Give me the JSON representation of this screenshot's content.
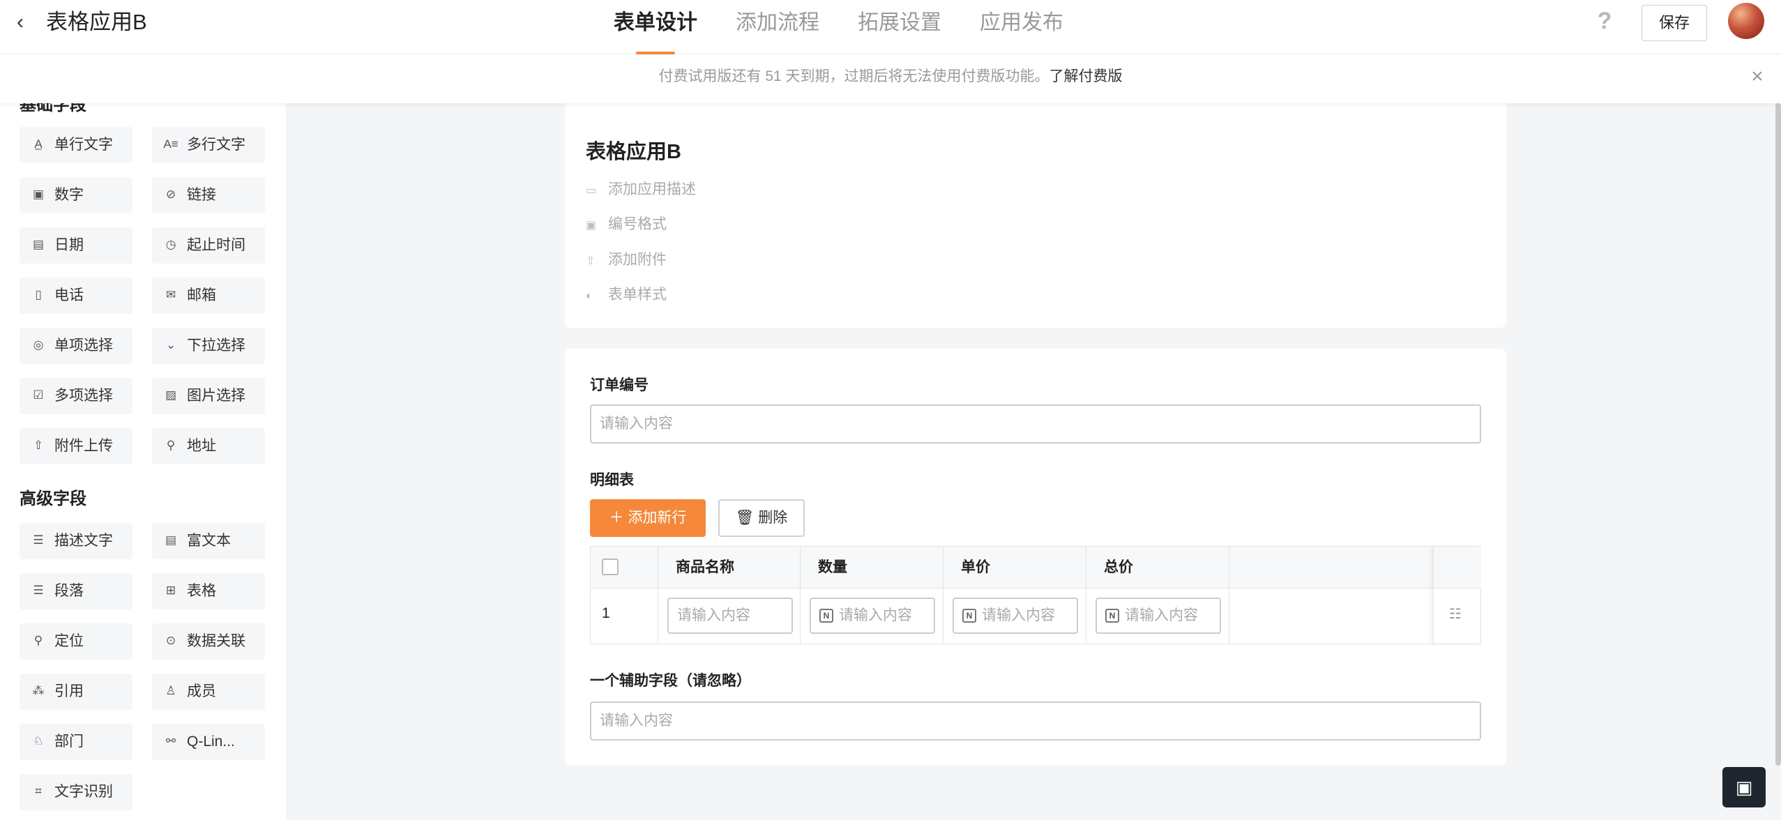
{
  "header": {
    "title": "表格应用B",
    "tabs": [
      {
        "label": "表单设计"
      },
      {
        "label": "添加流程"
      },
      {
        "label": "拓展设置"
      },
      {
        "label": "应用发布"
      }
    ],
    "help_glyph": "?",
    "save_label": "保存"
  },
  "notice": {
    "text": "付费试用版还有 51 天到期，过期后将无法使用付费版功能。",
    "link": "了解付费版"
  },
  "sidebar": {
    "basic_title": "基础字段",
    "basic_fields": [
      {
        "label": "单行文字",
        "icon": "single-line-text-icon"
      },
      {
        "label": "多行文字",
        "icon": "multi-line-text-icon"
      },
      {
        "label": "数字",
        "icon": "number-icon"
      },
      {
        "label": "链接",
        "icon": "link-icon"
      },
      {
        "label": "日期",
        "icon": "calendar-icon"
      },
      {
        "label": "起止时间",
        "icon": "time-range-icon"
      },
      {
        "label": "电话",
        "icon": "phone-icon"
      },
      {
        "label": "邮箱",
        "icon": "mail-icon"
      },
      {
        "label": "单项选择",
        "icon": "radio-icon"
      },
      {
        "label": "下拉选择",
        "icon": "dropdown-icon"
      },
      {
        "label": "多项选择",
        "icon": "checkbox-icon"
      },
      {
        "label": "图片选择",
        "icon": "image-icon"
      },
      {
        "label": "附件上传",
        "icon": "upload-icon"
      },
      {
        "label": "地址",
        "icon": "address-icon"
      }
    ],
    "advanced_title": "高级字段",
    "advanced_fields": [
      {
        "label": "描述文字",
        "icon": "description-icon"
      },
      {
        "label": "富文本",
        "icon": "rich-text-icon"
      },
      {
        "label": "段落",
        "icon": "paragraph-icon"
      },
      {
        "label": "表格",
        "icon": "table-icon"
      },
      {
        "label": "定位",
        "icon": "location-icon"
      },
      {
        "label": "数据关联",
        "icon": "data-link-icon"
      },
      {
        "label": "引用",
        "icon": "reference-icon"
      },
      {
        "label": "成员",
        "icon": "member-icon"
      },
      {
        "label": "部门",
        "icon": "department-icon"
      },
      {
        "label": "Q-Lin...",
        "icon": "q-link-icon"
      },
      {
        "label": "文字识别",
        "icon": "ocr-icon"
      }
    ]
  },
  "form_header": {
    "title": "表格应用B",
    "meta": [
      {
        "label": "添加应用描述",
        "icon": "comment-icon"
      },
      {
        "label": "编号格式",
        "icon": "number-format-icon"
      },
      {
        "label": "添加附件",
        "icon": "attachment-icon"
      },
      {
        "label": "表单样式",
        "icon": "palette-icon"
      }
    ]
  },
  "form": {
    "order_label": "订单编号",
    "order_placeholder": "请输入内容",
    "detail_label": "明细表",
    "add_row_label": "添加新行",
    "delete_label": "删除",
    "columns": [
      "商品名称",
      "数量",
      "单价",
      "总价"
    ],
    "row_number": "1",
    "cell_placeholder": "请输入内容",
    "number_glyph": "N",
    "aux_label": "一个辅助字段（请忽略）",
    "aux_placeholder": "请输入内容"
  }
}
